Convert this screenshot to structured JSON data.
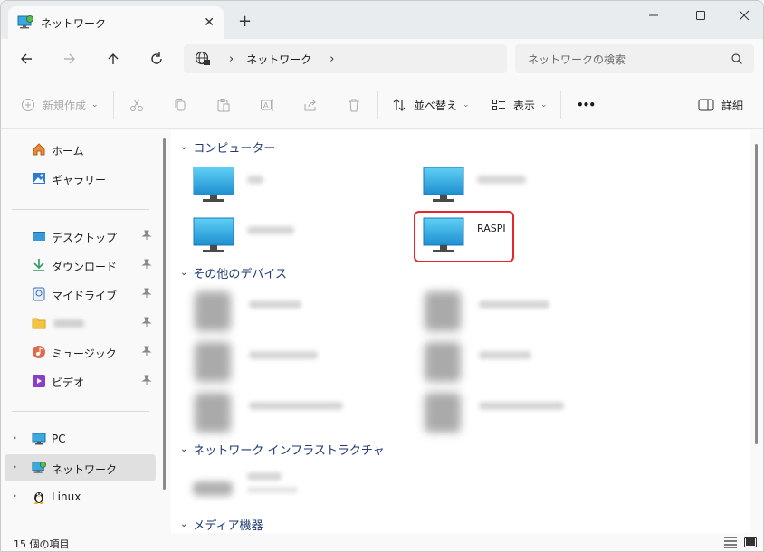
{
  "window": {
    "tab_title": "ネットワーク",
    "new_tab": "+",
    "controls": {
      "minimize": "—",
      "maximize": "☐",
      "close": "✕"
    }
  },
  "nav": {
    "breadcrumb": [
      "ネットワーク"
    ],
    "search_placeholder": "ネットワークの検索"
  },
  "toolbar": {
    "new_label": "新規作成",
    "sort_label": "並べ替え",
    "view_label": "表示",
    "more_label": "•••",
    "details_label": "詳細"
  },
  "sidebar": {
    "quick": [
      {
        "label": "ホーム",
        "icon": "home-icon"
      },
      {
        "label": "ギャラリー",
        "icon": "gallery-icon"
      }
    ],
    "pinned": [
      {
        "label": "デスクトップ",
        "icon": "desktop-folder-icon"
      },
      {
        "label": "ダウンロード",
        "icon": "download-icon"
      },
      {
        "label": "マイドライブ",
        "icon": "drive-icon"
      },
      {
        "label": "",
        "icon": "folder-icon"
      },
      {
        "label": "ミュージック",
        "icon": "music-icon"
      },
      {
        "label": "ビデオ",
        "icon": "video-icon"
      }
    ],
    "tree": [
      {
        "label": "PC",
        "icon": "pc-icon"
      },
      {
        "label": "ネットワーク",
        "icon": "network-icon",
        "selected": true
      },
      {
        "label": "Linux",
        "icon": "linux-penguin-icon"
      }
    ]
  },
  "content": {
    "groups": [
      {
        "title": "コンピューター"
      },
      {
        "title": "その他のデバイス"
      },
      {
        "title": "ネットワーク インフラストラクチャ"
      },
      {
        "title": "メディア機器"
      }
    ],
    "computers": [
      {
        "label": ""
      },
      {
        "label": ""
      },
      {
        "label": ""
      },
      {
        "label": "RASPI"
      }
    ]
  },
  "status": {
    "item_count": "15 個の項目"
  },
  "colors": {
    "accent": "#1e3a73",
    "highlight_box": "#e8262c",
    "monitor_blue": "#3aa9df"
  }
}
